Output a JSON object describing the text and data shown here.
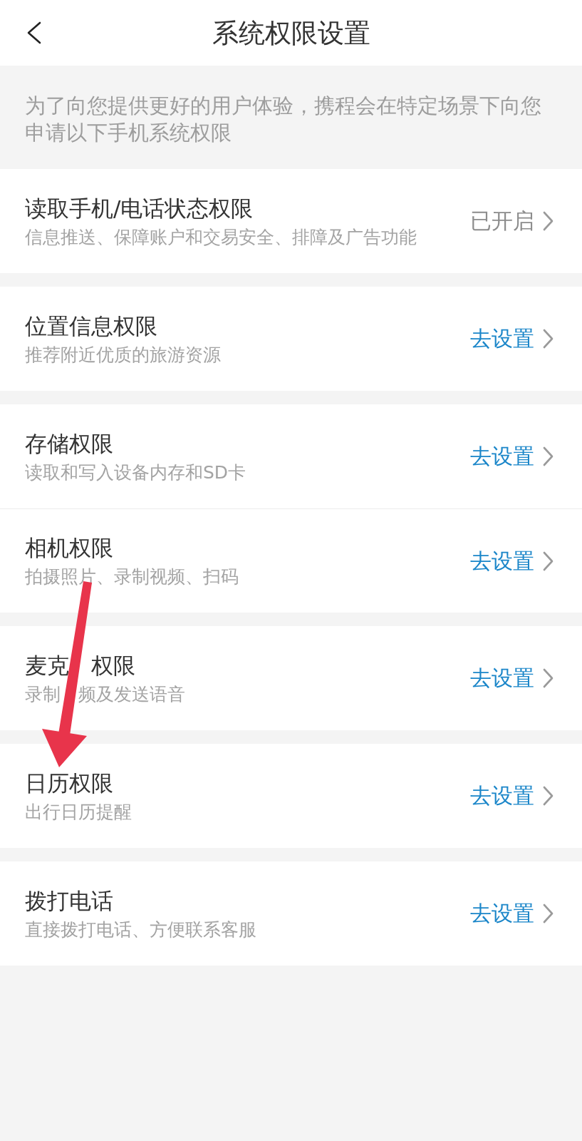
{
  "header": {
    "title": "系统权限设置"
  },
  "intro": "为了向您提供更好的用户体验，携程会在特定场景下向您申请以下手机系统权限",
  "groups": [
    {
      "items": [
        {
          "title": "读取手机/电话状态权限",
          "subtitle": "信息推送、保障账户和交易安全、排障及广告功能",
          "status": "已开启",
          "granted": true
        }
      ]
    },
    {
      "items": [
        {
          "title": "位置信息权限",
          "subtitle": "推荐附近优质的旅游资源",
          "status": "去设置",
          "granted": false
        }
      ]
    },
    {
      "items": [
        {
          "title": "存储权限",
          "subtitle": "读取和写入设备内存和SD卡",
          "status": "去设置",
          "granted": false
        },
        {
          "title": "相机权限",
          "subtitle": "拍摄照片、录制视频、扫码",
          "status": "去设置",
          "granted": false
        }
      ]
    },
    {
      "items": [
        {
          "title": "麦克 权限",
          "subtitle": "录制 频及发送语音",
          "status": "去设置",
          "granted": false
        }
      ]
    },
    {
      "items": [
        {
          "title": "日历权限",
          "subtitle": "出行日历提醒",
          "status": "去设置",
          "granted": false
        }
      ]
    },
    {
      "items": [
        {
          "title": "拨打电话",
          "subtitle": "直接拨打电话、方便联系客服",
          "status": "去设置",
          "granted": false
        }
      ]
    }
  ]
}
